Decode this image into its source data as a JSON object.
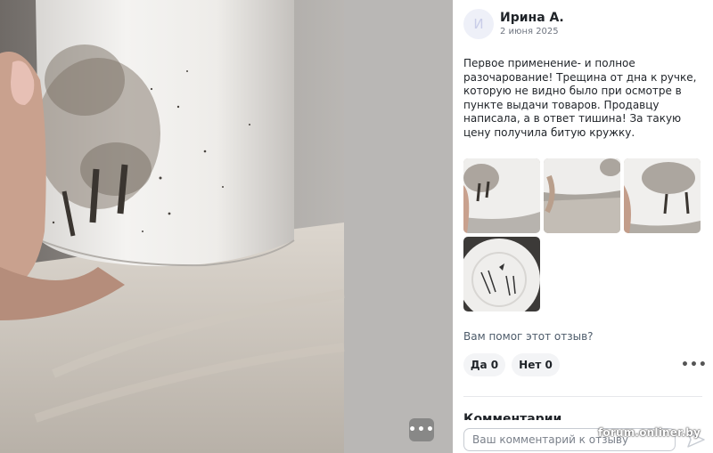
{
  "review": {
    "author_initial": "И",
    "author_name": "Ирина А.",
    "date": "2 июня 2025",
    "text": "Первое применение- и полное разочарование! Трещина от дна к ручке, которую не видно было при осмотре в пункте выдачи товаров. Продавцу написала, а в ответ тишина! За такую цену получила битую кружку."
  },
  "photos": [
    {
      "name": "photo-thumb-1",
      "icon": "mug-photo"
    },
    {
      "name": "photo-thumb-2",
      "icon": "mug-bottom-photo"
    },
    {
      "name": "photo-thumb-3",
      "icon": "mug-side-photo"
    },
    {
      "name": "photo-thumb-4",
      "icon": "mug-stamp-photo"
    }
  ],
  "feedback": {
    "question": "Вам помог этот отзыв?",
    "yes_label": "Да 0",
    "no_label": "Нет 0"
  },
  "comments": {
    "heading": "Комментарии",
    "placeholder": "Ваш комментарий к отзыву"
  },
  "watermark": "forum.onliner.by",
  "viewer": {
    "more_icon": "more-horizontal-icon"
  },
  "colors": {
    "accent": "#1f2328",
    "muted": "#4d5b6a",
    "button_bg": "#f3f4f6"
  }
}
